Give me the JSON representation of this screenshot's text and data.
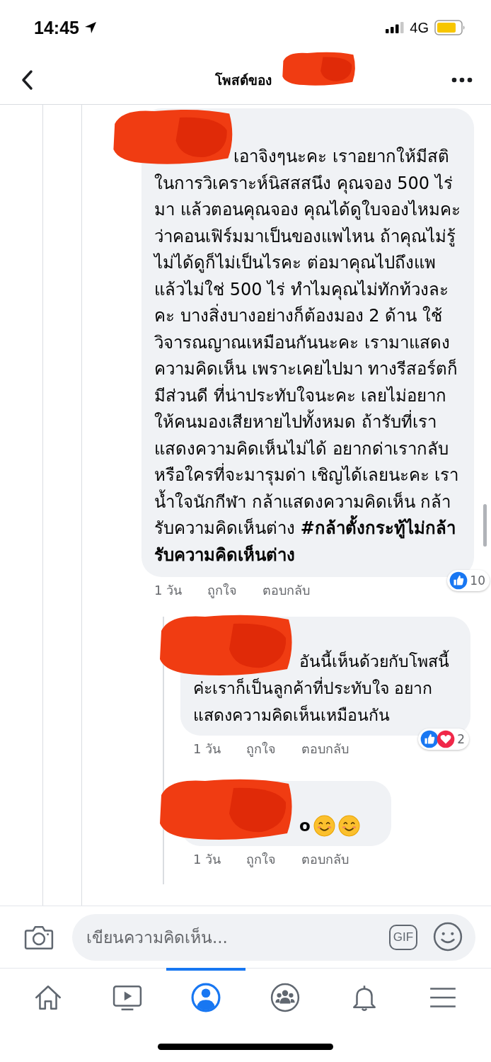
{
  "status_bar": {
    "time": "14:45",
    "network": "4G"
  },
  "header": {
    "title": "โพสต์ของ",
    "title_redacted": true
  },
  "comments": [
    {
      "name_redacted": true,
      "text": "เอาจิงๆนะคะ เราอยากให้มีสติในการวิเคราะห์นิสสสนึง คุณจอง 500 ไร่มา แล้วตอนคุณจอง คุณได้ดูใบจองไหมคะว่าคอนเฟิร์มมาเป็นของแพไหน ถ้าคุณไม่รู้ ไม่ได้ดูก็ไม่เป็นไรคะ ต่อมาคุณไปถึงแพ แล้วไม่ใช่ 500 ไร่ ทำไมคุณไม่ทักท้วงละคะ บางสิ่งบางอย่างก็ต้องมอง 2 ด้าน ใช้วิจารณญาณเหมือนกันนะคะ เรามาแสดงความคิดเห็น เพราะเคยไปมา ทางรีสอร์ตก็มีส่วนดี ที่น่าประทับใจนะคะ เลยไม่อยากให้คนมองเสียหายไปทั้งหมด ถ้ารับที่เราแสดงความคิดเห็นไม่ได้ อยากด่าเรากลับ หรือใครที่จะมารุมด่า เชิญได้เลยนะคะ เราน้ำใจนักกีฬา กล้าแสดงความคิดเห็น กล้ารับความคิดเห็นต่าง **#กล้าตั้งกระทู้ไม่กล้ารับความคิดเห็นต่าง**",
      "time": "1 วัน",
      "like_label": "ถูกใจ",
      "reply_label": "ตอบกลับ",
      "reactions": [
        {
          "kind": "like"
        }
      ],
      "reaction_count": "10",
      "replies": [
        {
          "name_redacted": true,
          "text": "อันนี้เห็นด้วยกับโพสนี้ค่ะเราก็เป็นลูกค้าที่ประทับใจ อยากแสดงความคิดเห็นเหมือนกัน",
          "time": "1 วัน",
          "like_label": "ถูกใจ",
          "reply_label": "ตอบกลับ",
          "reactions": [
            {
              "kind": "like"
            },
            {
              "kind": "love"
            }
          ],
          "reaction_count": "2"
        },
        {
          "name_redacted": true,
          "text": "o",
          "emojis": [
            {
              "kind": "smile"
            },
            {
              "kind": "smile"
            }
          ],
          "time": "1 วัน",
          "like_label": "ถูกใจ",
          "reply_label": "ตอบกลับ"
        }
      ]
    }
  ],
  "composer": {
    "placeholder": "เขียนความคิดเห็น...",
    "gif_label": "GIF"
  },
  "nav": [
    {
      "selected": false
    },
    {
      "selected": false
    },
    {
      "selected": true
    },
    {
      "selected": false
    },
    {
      "selected": false
    },
    {
      "selected": false
    }
  ]
}
